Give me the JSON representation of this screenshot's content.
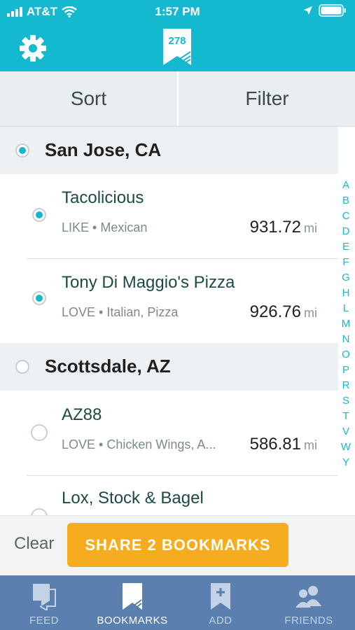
{
  "status": {
    "carrier": "AT&T",
    "time": "1:57 PM"
  },
  "header": {
    "logo_number": "278"
  },
  "toolbar": {
    "sort_label": "Sort",
    "filter_label": "Filter"
  },
  "sections": [
    {
      "title": "San Jose, CA",
      "selected": true,
      "items": [
        {
          "name": "Tacolicious",
          "sub": "LIKE • Mexican",
          "distance": "931.72",
          "unit": "mi",
          "selected": true
        },
        {
          "name": "Tony Di Maggio's Pizza",
          "sub": "LOVE • Italian, Pizza",
          "distance": "926.76",
          "unit": "mi",
          "selected": true
        }
      ]
    },
    {
      "title": "Scottsdale, AZ",
      "selected": false,
      "items": [
        {
          "name": "AZ88",
          "sub": "LOVE • Chicken Wings, A...",
          "distance": "586.81",
          "unit": "mi",
          "selected": false
        },
        {
          "name": "Lox, Stock & Bagel",
          "sub": "",
          "distance": "",
          "unit": "",
          "selected": false
        }
      ]
    }
  ],
  "index_letters": [
    "A",
    "B",
    "C",
    "D",
    "E",
    "F",
    "G",
    "H",
    "L",
    "M",
    "N",
    "O",
    "P",
    "R",
    "S",
    "T",
    "V",
    "W",
    "Y"
  ],
  "actions": {
    "clear_label": "Clear",
    "share_label": "SHARE 2 BOOKMARKS"
  },
  "tabs": [
    {
      "label": "FEED",
      "icon": "feed-icon",
      "active": false
    },
    {
      "label": "BOOKMARKS",
      "icon": "bookmark-icon",
      "active": true
    },
    {
      "label": "ADD",
      "icon": "add-icon",
      "active": false
    },
    {
      "label": "FRIENDS",
      "icon": "friends-icon",
      "active": false
    }
  ],
  "colors": {
    "brand": "#14b8cf",
    "accent": "#f5ac1f",
    "tabbar": "#5b7fae"
  }
}
